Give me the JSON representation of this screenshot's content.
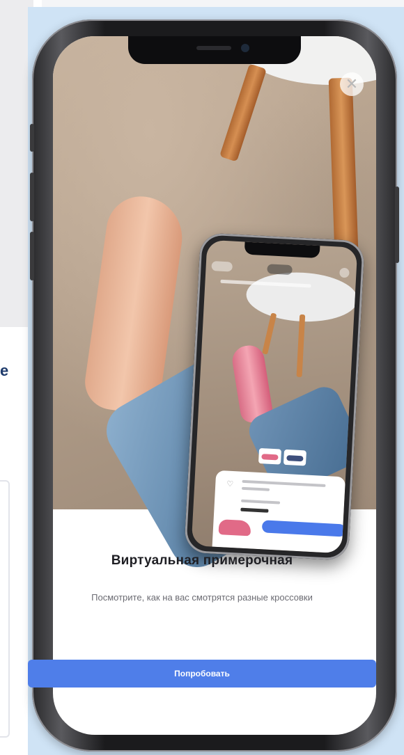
{
  "background_page": {
    "visible_letter": "e"
  },
  "ar_promo": {
    "title": "Виртуальная примерочная",
    "subtitle": "Посмотрите, как на вас смотрятся разные кроссовки",
    "try_button_label": "Попробовать",
    "close_icon": "close-icon"
  },
  "colors": {
    "accent_blue": "#4f7ee9",
    "panel_blue": "#cfe3f5"
  }
}
